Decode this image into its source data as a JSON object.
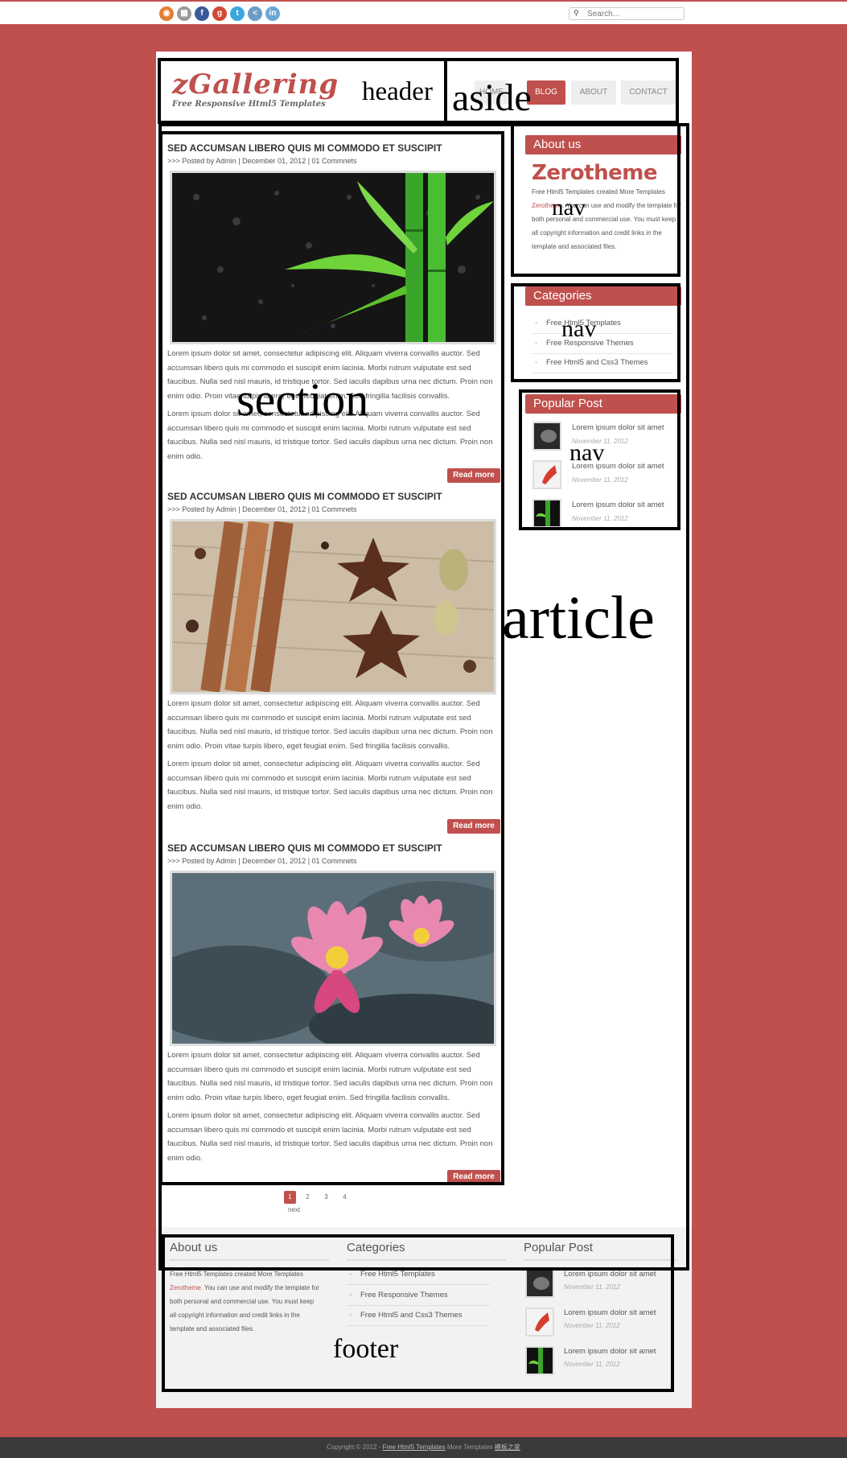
{
  "topbar": {
    "social_icons": [
      {
        "name": "rss-icon",
        "glyph": "◉",
        "color": "#e37e32"
      },
      {
        "name": "delicious-icon",
        "glyph": "▦",
        "color": "#9a9a9a"
      },
      {
        "name": "facebook-icon",
        "glyph": "f",
        "color": "#3b5998"
      },
      {
        "name": "google-plus-icon",
        "glyph": "g",
        "color": "#d34836"
      },
      {
        "name": "twitter-icon",
        "glyph": "t",
        "color": "#3ca7de"
      },
      {
        "name": "share-icon",
        "glyph": "<",
        "color": "#6c9bc7"
      },
      {
        "name": "linkedin-icon",
        "glyph": "in",
        "color": "#6aa8d4"
      }
    ],
    "search_placeholder": "Search..."
  },
  "header": {
    "logo_title": "zGallering",
    "logo_subtitle": "Free Responsive Html5 Templates"
  },
  "menu": [
    {
      "label": "HOME",
      "active": false
    },
    {
      "label": "BLOG",
      "active": true
    },
    {
      "label": "ABOUT",
      "active": false
    },
    {
      "label": "CONTACT",
      "active": false
    }
  ],
  "annotations": {
    "header": "header",
    "aside": "aside",
    "nav1": "nav",
    "nav2": "nav",
    "nav3": "nav",
    "section": "section",
    "article": "article",
    "footer": "footer"
  },
  "posts": [
    {
      "title": "SED ACCUMSAN LIBERO QUIS MI COMMODO ET SUSCIPIT",
      "meta": ">>> Posted by Admin | December 01, 2012 | 01 Commnets",
      "image": "bamboo",
      "para1": "Lorem ipsum dolor sit amet, consectetur adipiscing elit. Aliquam viverra convallis auctor. Sed accumsan libero quis mi commodo et suscipit enim lacinia. Morbi rutrum vulputate est sed faucibus. Nulla sed nisl mauris, id tristique tortor. Sed iaculis dapibus urna nec dictum. Proin non enim odio. Proin vitae turpis libero, eget feugiat enim. Sed fringilla facilisis convallis.",
      "para2": "Lorem ipsum dolor sit amet, consectetur adipiscing elit. Aliquam viverra convallis auctor. Sed accumsan libero quis mi commodo et suscipit enim lacinia. Morbi rutrum vulputate est sed faucibus. Nulla sed nisl mauris, id tristique tortor. Sed iaculis dapibus urna nec dictum. Proin non enim odio.",
      "read_more": "Read more"
    },
    {
      "title": "SED ACCUMSAN LIBERO QUIS MI COMMODO ET SUSCIPIT",
      "meta": ">>> Posted by Admin | December 01, 2012 | 01 Commnets",
      "image": "spices",
      "para1": "Lorem ipsum dolor sit amet, consectetur adipiscing elit. Aliquam viverra convallis auctor. Sed accumsan libero quis mi commodo et suscipit enim lacinia. Morbi rutrum vulputate est sed faucibus. Nulla sed nisl mauris, id tristique tortor. Sed iaculis dapibus urna nec dictum. Proin non enim odio. Proin vitae turpis libero, eget feugiat enim. Sed fringilla facilisis convallis.",
      "para2": "Lorem ipsum dolor sit amet, consectetur adipiscing elit. Aliquam viverra convallis auctor. Sed accumsan libero quis mi commodo et suscipit enim lacinia. Morbi rutrum vulputate est sed faucibus. Nulla sed nisl mauris, id tristique tortor. Sed iaculis dapibus urna nec dictum. Proin non enim odio.",
      "read_more": "Read more"
    },
    {
      "title": "SED ACCUMSAN LIBERO QUIS MI COMMODO ET SUSCIPIT",
      "meta": ">>> Posted by Admin | December 01, 2012 | 01 Commnets",
      "image": "lotus",
      "para1": "Lorem ipsum dolor sit amet, consectetur adipiscing elit. Aliquam viverra convallis auctor. Sed accumsan libero quis mi commodo et suscipit enim lacinia. Morbi rutrum vulputate est sed faucibus. Nulla sed nisl mauris, id tristique tortor. Sed iaculis dapibus urna nec dictum. Proin non enim odio. Proin vitae turpis libero, eget feugiat enim. Sed fringilla facilisis convallis.",
      "para2": "Lorem ipsum dolor sit amet, consectetur adipiscing elit. Aliquam viverra convallis auctor. Sed accumsan libero quis mi commodo et suscipit enim lacinia. Morbi rutrum vulputate est sed faucibus. Nulla sed nisl mauris, id tristique tortor. Sed iaculis dapibus urna nec dictum. Proin non enim odio.",
      "read_more": "Read more"
    }
  ],
  "sidebar": {
    "about": {
      "title": "About us",
      "logo_text": "Zerotheme",
      "tagline": "Free Html5 Templates created More Templates",
      "link": "Zerotheme",
      "rest": ". You can use and modify the template for both personal and commercial use. You must keep all copyright information and credit links in the template and associated files."
    },
    "categories": {
      "title": "Categories",
      "items": [
        "Free Html5 Templates",
        "Free Responsive Themes",
        "Free Html5 and Css3 Themes"
      ]
    },
    "popular": {
      "title": "Popular Post",
      "items": [
        {
          "title": "Lorem ipsum dolor sit amet",
          "date": "November 11, 2012",
          "thumb": "dark"
        },
        {
          "title": "Lorem ipsum dolor sit amet",
          "date": "November 11, 2012",
          "thumb": "red"
        },
        {
          "title": "Lorem ipsum dolor sit amet",
          "date": "November 11, 2012",
          "thumb": "green"
        }
      ]
    }
  },
  "pagination": {
    "pages": [
      "1",
      "2",
      "3",
      "4"
    ],
    "active": "1",
    "next": "next"
  },
  "footer": {
    "about": {
      "title": "About us",
      "tagline": "Free Html5 Templates created More Templates",
      "link": "Zerotheme",
      "rest": ". You can use and modify the template for both personal and commercial use. You must keep all copyright information and credit links in the template and associated files."
    },
    "categories": {
      "title": "Categories",
      "items": [
        "Free Html5 Templates",
        "Free Responsive Themes",
        "Free Html5 and Css3 Themes"
      ]
    },
    "popular": {
      "title": "Popular Post",
      "items": [
        {
          "title": "Lorem ipsum dolor sit amet",
          "date": "November 11, 2012"
        },
        {
          "title": "Lorem ipsum dolor sit amet",
          "date": "November 11, 2012"
        },
        {
          "title": "Lorem ipsum dolor sit amet",
          "date": "November 11, 2012"
        }
      ]
    }
  },
  "copyright": {
    "prefix": "Copyright © 2012 - ",
    "link1": "Free Html5 Templates",
    "middle": " More Templates ",
    "link2": "模板之家"
  },
  "colors": {
    "accent": "#c0504d",
    "bottombar": "#3a3a3a"
  }
}
